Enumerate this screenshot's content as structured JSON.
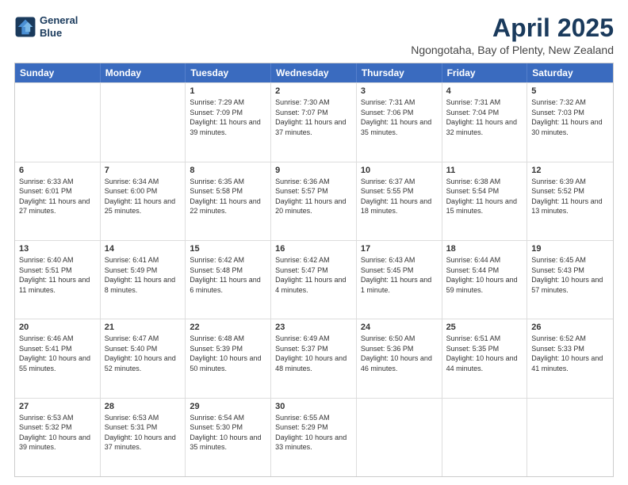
{
  "logo": {
    "line1": "General",
    "line2": "Blue"
  },
  "title": "April 2025",
  "subtitle": "Ngongotaha, Bay of Plenty, New Zealand",
  "days": [
    "Sunday",
    "Monday",
    "Tuesday",
    "Wednesday",
    "Thursday",
    "Friday",
    "Saturday"
  ],
  "weeks": [
    [
      {
        "day": "",
        "info": ""
      },
      {
        "day": "",
        "info": ""
      },
      {
        "day": "1",
        "info": "Sunrise: 7:29 AM\nSunset: 7:09 PM\nDaylight: 11 hours and 39 minutes."
      },
      {
        "day": "2",
        "info": "Sunrise: 7:30 AM\nSunset: 7:07 PM\nDaylight: 11 hours and 37 minutes."
      },
      {
        "day": "3",
        "info": "Sunrise: 7:31 AM\nSunset: 7:06 PM\nDaylight: 11 hours and 35 minutes."
      },
      {
        "day": "4",
        "info": "Sunrise: 7:31 AM\nSunset: 7:04 PM\nDaylight: 11 hours and 32 minutes."
      },
      {
        "day": "5",
        "info": "Sunrise: 7:32 AM\nSunset: 7:03 PM\nDaylight: 11 hours and 30 minutes."
      }
    ],
    [
      {
        "day": "6",
        "info": "Sunrise: 6:33 AM\nSunset: 6:01 PM\nDaylight: 11 hours and 27 minutes."
      },
      {
        "day": "7",
        "info": "Sunrise: 6:34 AM\nSunset: 6:00 PM\nDaylight: 11 hours and 25 minutes."
      },
      {
        "day": "8",
        "info": "Sunrise: 6:35 AM\nSunset: 5:58 PM\nDaylight: 11 hours and 22 minutes."
      },
      {
        "day": "9",
        "info": "Sunrise: 6:36 AM\nSunset: 5:57 PM\nDaylight: 11 hours and 20 minutes."
      },
      {
        "day": "10",
        "info": "Sunrise: 6:37 AM\nSunset: 5:55 PM\nDaylight: 11 hours and 18 minutes."
      },
      {
        "day": "11",
        "info": "Sunrise: 6:38 AM\nSunset: 5:54 PM\nDaylight: 11 hours and 15 minutes."
      },
      {
        "day": "12",
        "info": "Sunrise: 6:39 AM\nSunset: 5:52 PM\nDaylight: 11 hours and 13 minutes."
      }
    ],
    [
      {
        "day": "13",
        "info": "Sunrise: 6:40 AM\nSunset: 5:51 PM\nDaylight: 11 hours and 11 minutes."
      },
      {
        "day": "14",
        "info": "Sunrise: 6:41 AM\nSunset: 5:49 PM\nDaylight: 11 hours and 8 minutes."
      },
      {
        "day": "15",
        "info": "Sunrise: 6:42 AM\nSunset: 5:48 PM\nDaylight: 11 hours and 6 minutes."
      },
      {
        "day": "16",
        "info": "Sunrise: 6:42 AM\nSunset: 5:47 PM\nDaylight: 11 hours and 4 minutes."
      },
      {
        "day": "17",
        "info": "Sunrise: 6:43 AM\nSunset: 5:45 PM\nDaylight: 11 hours and 1 minute."
      },
      {
        "day": "18",
        "info": "Sunrise: 6:44 AM\nSunset: 5:44 PM\nDaylight: 10 hours and 59 minutes."
      },
      {
        "day": "19",
        "info": "Sunrise: 6:45 AM\nSunset: 5:43 PM\nDaylight: 10 hours and 57 minutes."
      }
    ],
    [
      {
        "day": "20",
        "info": "Sunrise: 6:46 AM\nSunset: 5:41 PM\nDaylight: 10 hours and 55 minutes."
      },
      {
        "day": "21",
        "info": "Sunrise: 6:47 AM\nSunset: 5:40 PM\nDaylight: 10 hours and 52 minutes."
      },
      {
        "day": "22",
        "info": "Sunrise: 6:48 AM\nSunset: 5:39 PM\nDaylight: 10 hours and 50 minutes."
      },
      {
        "day": "23",
        "info": "Sunrise: 6:49 AM\nSunset: 5:37 PM\nDaylight: 10 hours and 48 minutes."
      },
      {
        "day": "24",
        "info": "Sunrise: 6:50 AM\nSunset: 5:36 PM\nDaylight: 10 hours and 46 minutes."
      },
      {
        "day": "25",
        "info": "Sunrise: 6:51 AM\nSunset: 5:35 PM\nDaylight: 10 hours and 44 minutes."
      },
      {
        "day": "26",
        "info": "Sunrise: 6:52 AM\nSunset: 5:33 PM\nDaylight: 10 hours and 41 minutes."
      }
    ],
    [
      {
        "day": "27",
        "info": "Sunrise: 6:53 AM\nSunset: 5:32 PM\nDaylight: 10 hours and 39 minutes."
      },
      {
        "day": "28",
        "info": "Sunrise: 6:53 AM\nSunset: 5:31 PM\nDaylight: 10 hours and 37 minutes."
      },
      {
        "day": "29",
        "info": "Sunrise: 6:54 AM\nSunset: 5:30 PM\nDaylight: 10 hours and 35 minutes."
      },
      {
        "day": "30",
        "info": "Sunrise: 6:55 AM\nSunset: 5:29 PM\nDaylight: 10 hours and 33 minutes."
      },
      {
        "day": "",
        "info": ""
      },
      {
        "day": "",
        "info": ""
      },
      {
        "day": "",
        "info": ""
      }
    ]
  ]
}
